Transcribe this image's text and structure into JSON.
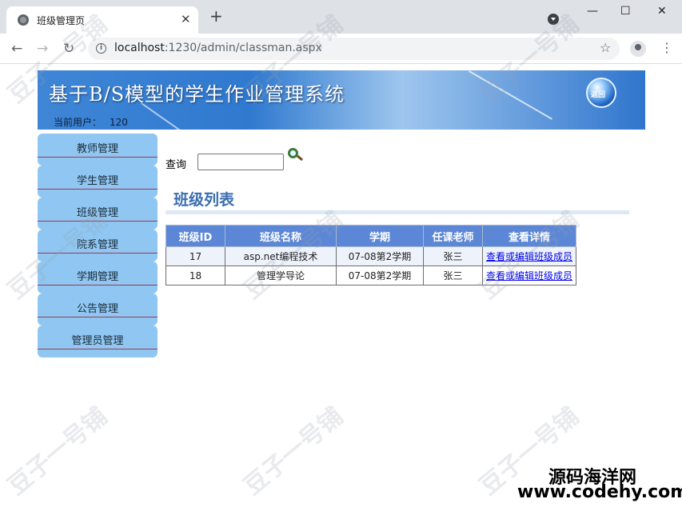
{
  "browser": {
    "tab_title": "班级管理页",
    "tab_close": "✕",
    "new_tab": "+",
    "win_min": "—",
    "win_max": "☐",
    "win_close": "✕",
    "url_host": "localhost",
    "url_path": ":1230/admin/classman.aspx",
    "back": "←",
    "forward": "→",
    "reload": "↻",
    "star": "☆",
    "menu": "⋮",
    "info": "i"
  },
  "banner": {
    "title": "基于B/S模型的学生作业管理系统",
    "user_label": "当前用户：",
    "user_value": "120",
    "logo_text": "返回"
  },
  "sidebar": {
    "items": [
      {
        "label": "教师管理"
      },
      {
        "label": "学生管理"
      },
      {
        "label": "班级管理"
      },
      {
        "label": "院系管理"
      },
      {
        "label": "学期管理"
      },
      {
        "label": "公告管理"
      },
      {
        "label": "管理员管理"
      }
    ]
  },
  "search": {
    "label": "查询",
    "value": ""
  },
  "list": {
    "title": "班级列表",
    "headers": [
      "班级ID",
      "班级名称",
      "学期",
      "任课老师",
      "查看详情"
    ],
    "rows": [
      {
        "id": "17",
        "name": "asp.net编程技术",
        "term": "07-08第2学期",
        "teacher": "张三",
        "link": "查看或编辑班级成员"
      },
      {
        "id": "18",
        "name": "管理学导论",
        "term": "07-08第2学期",
        "teacher": "张三",
        "link": "查看或编辑班级成员"
      }
    ]
  },
  "watermark": {
    "text": "豆子一号铺",
    "brand_cn": "源码海洋网",
    "brand_url": "www.codehy.com"
  },
  "colors": {
    "banner": "#2f79cf",
    "sidebar": "#8fc7f2",
    "table_header": "#5b87d6",
    "title": "#3a6db0"
  }
}
